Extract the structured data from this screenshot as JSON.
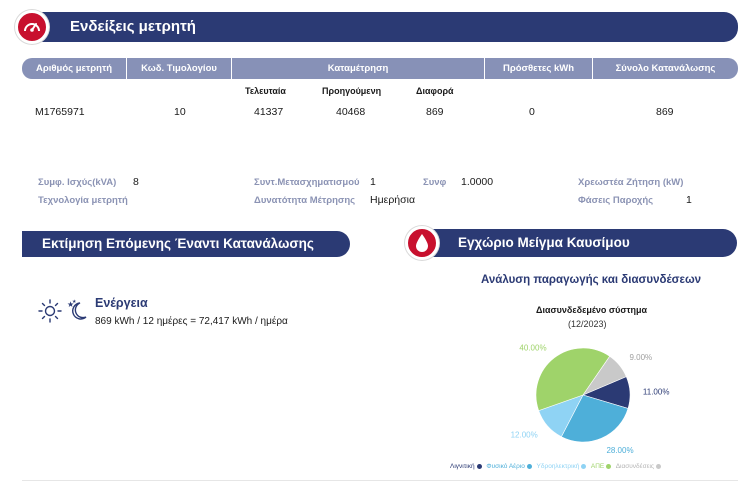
{
  "meter_section": {
    "title": "Ενδείξεις μετρητή",
    "headers": [
      "Αριθμός μετρητή",
      "Κωδ. Τιμολογίου",
      "Καταμέτρηση",
      "Πρόσθετες kWh",
      "Σύνολο Κατανάλωσης"
    ],
    "subheaders": [
      "Τελευταία",
      "Προηγούμενη",
      "Διαφορά"
    ],
    "row": {
      "meter_number": "M1765971",
      "tariff_code": "10",
      "last": "41337",
      "previous": "40468",
      "difference": "869",
      "additional_kwh": "0",
      "total": "869"
    }
  },
  "info": {
    "power_label": "Συμφ. Ισχύς(kVA)",
    "power_value": "8",
    "ratio_label": "Συντ.Μετασχηματισμού",
    "ratio_value": "1",
    "cosphi_label": "Συνφ",
    "cosphi_value": "1.0000",
    "demand_label": "Χρεωστέα Ζήτηση (kW)",
    "demand_value": "",
    "tech_label": "Τεχνολογία μετρητή",
    "tech_value": "",
    "capability_label": "Δυνατότητα Μέτρησης",
    "capability_value": "Ημερήσια",
    "phases_label": "Φάσεις Παροχής",
    "phases_value": "1"
  },
  "estimation": {
    "title": "Εκτίμηση Επόμενης Έναντι Κατανάλωσης",
    "energy_label": "Ενέργεια",
    "energy_text": "869 kWh / 12 ημέρες = 72,417 kWh / ημέρα"
  },
  "fuel": {
    "title": "Εγχώριο Μείγμα Καυσίμου",
    "subtitle": "Ανάλυση παραγωγής και διασυνδέσεων"
  },
  "chart_data": {
    "type": "pie",
    "title": "Διασυνδεδεμένο σύστημα",
    "subtitle": "(12/2023)",
    "legend_position": "bottom",
    "series": [
      {
        "name": "Λιγνιτική",
        "value": 11.0,
        "label": "11.00%",
        "color": "#2b3a74"
      },
      {
        "name": "Φυσικό Αέριο",
        "value": 28.0,
        "label": "28.00%",
        "color": "#4eafd9"
      },
      {
        "name": "Υδροηλεκτρική",
        "value": 12.0,
        "label": "12.00%",
        "color": "#8fd3f4"
      },
      {
        "name": "ΑΠΕ",
        "value": 40.0,
        "label": "40.00%",
        "color": "#9fd36a"
      },
      {
        "name": "Διασυνδέσεις",
        "value": 9.0,
        "label": "9.00%",
        "color": "#c9c9c9"
      }
    ]
  },
  "colors": {
    "primary": "#2b3a74",
    "accent": "#c8102e",
    "header_row": "#8791b7",
    "label": "#8b93b4"
  },
  "icons": {
    "meter": "speedometer-icon",
    "fuel": "drop-icon",
    "energy": "sun-moon-icon"
  }
}
